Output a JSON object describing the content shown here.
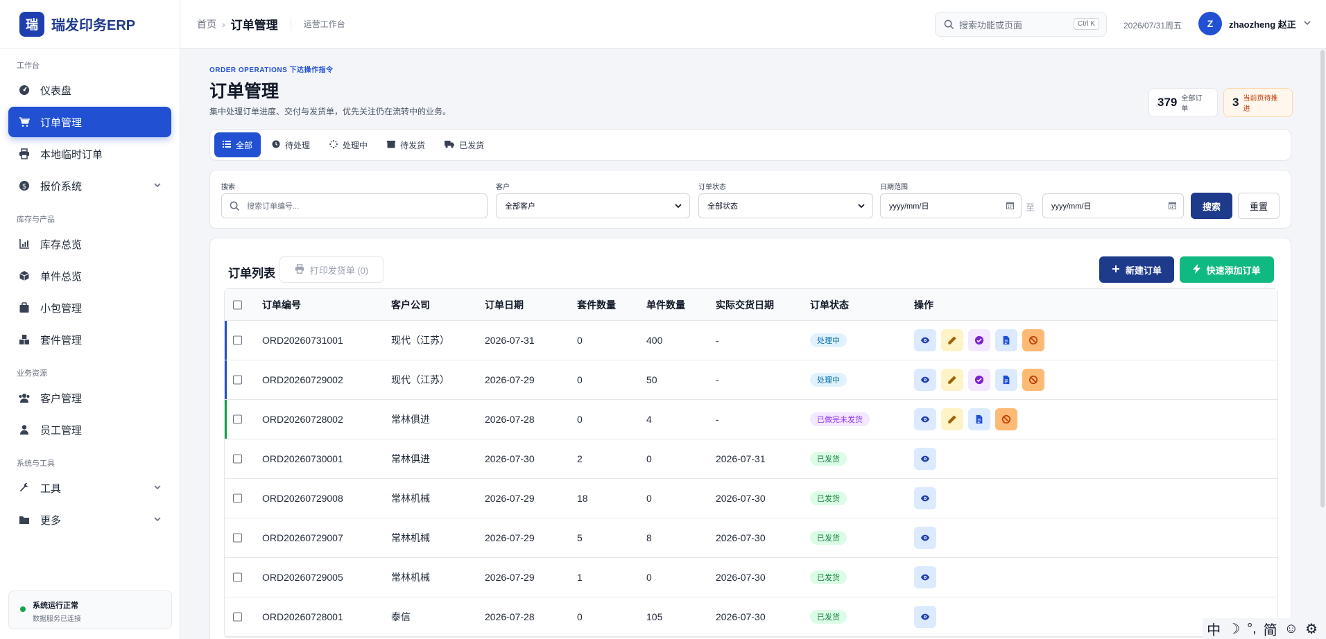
{
  "brand": {
    "logo_char": "瑞",
    "name": "瑞发印务ERP"
  },
  "sidebar": {
    "sections": {
      "workbench": "工作台",
      "inventory": "库存与产品",
      "business": "业务资源",
      "system": "系统与工具"
    },
    "items": [
      {
        "label": "仪表盘",
        "icon": "dashboard-icon"
      },
      {
        "label": "订单管理",
        "icon": "cart-icon",
        "active": true
      },
      {
        "label": "本地临时订单",
        "icon": "printer-icon"
      },
      {
        "label": "报价系统",
        "icon": "quote-icon"
      },
      {
        "label": "库存总览",
        "icon": "chart-icon"
      },
      {
        "label": "单件总览",
        "icon": "box-icon"
      },
      {
        "label": "小包管理",
        "icon": "package-icon"
      },
      {
        "label": "套件管理",
        "icon": "boxes-icon"
      },
      {
        "label": "客户管理",
        "icon": "users-icon"
      },
      {
        "label": "员工管理",
        "icon": "user-icon"
      },
      {
        "label": "工具",
        "icon": "wrench-icon"
      },
      {
        "label": "更多",
        "icon": "folder-icon"
      }
    ],
    "status": {
      "title": "系统运行正常",
      "sub": "数据服务已连接"
    }
  },
  "topbar": {
    "breadcrumb_home": "首页",
    "breadcrumb_current": "订单管理",
    "breadcrumb_tag": "运营工作台",
    "search_placeholder": "搜索功能或页面",
    "search_shortcut": "Ctrl K",
    "date": "2026/07/31周五",
    "user_initial": "Z",
    "user_name": "zhaozheng 赵正"
  },
  "page": {
    "eyebrow": "ORDER OPERATIONS  下达操作指令",
    "title": "订单管理",
    "description": "集中处理订单进度、交付与发货单，优先关注仍在流转中的业务。",
    "stat_all_num": "379",
    "stat_all_label": "全部订单",
    "stat_pending_num": "3",
    "stat_pending_label": "当前页待推进"
  },
  "tabs": [
    {
      "label": "全部",
      "icon": "list-icon"
    },
    {
      "label": "待处理",
      "icon": "clock-icon"
    },
    {
      "label": "处理中",
      "icon": "spinner-icon"
    },
    {
      "label": "待发货",
      "icon": "box-icon"
    },
    {
      "label": "已发货",
      "icon": "truck-icon"
    }
  ],
  "filters": {
    "search_label": "搜索",
    "search_placeholder": "搜索订单编号...",
    "customer_label": "客户",
    "customer_value": "全部客户",
    "status_label": "订单状态",
    "status_value": "全部状态",
    "date_label": "日期范围",
    "date_from": "yyyy/mm/日",
    "date_to": "yyyy/mm/日",
    "to_word": "至",
    "search_button": "搜索",
    "reset_button": "重置"
  },
  "list": {
    "title": "订单列表",
    "print_button": "打印发货单 (0)",
    "new_button": "新建订单",
    "quick_button": "快速添加订单"
  },
  "table": {
    "headers": [
      "订单编号",
      "客户公司",
      "订单日期",
      "套件数量",
      "单件数量",
      "实际交货日期",
      "订单状态",
      "操作"
    ],
    "rows": [
      {
        "id": "ORD20260731001",
        "customer": "现代（江苏）",
        "date": "2026-07-31",
        "kits": "0",
        "units": "400",
        "delivered": "-",
        "status": "处理中",
        "status_type": "processing",
        "bar": "blue",
        "actions": [
          "view",
          "edit",
          "confirm",
          "doc",
          "cancel"
        ]
      },
      {
        "id": "ORD20260729002",
        "customer": "现代（江苏）",
        "date": "2026-07-29",
        "kits": "0",
        "units": "50",
        "delivered": "-",
        "status": "处理中",
        "status_type": "processing",
        "bar": "blue",
        "actions": [
          "view",
          "edit",
          "confirm",
          "doc",
          "cancel"
        ]
      },
      {
        "id": "ORD20260728002",
        "customer": "常林俱进",
        "date": "2026-07-28",
        "kits": "0",
        "units": "4",
        "delivered": "-",
        "status": "已做完未发货",
        "status_type": "done",
        "bar": "green",
        "actions": [
          "view",
          "edit",
          "doc",
          "cancel"
        ]
      },
      {
        "id": "ORD20260730001",
        "customer": "常林俱进",
        "date": "2026-07-30",
        "kits": "2",
        "units": "0",
        "delivered": "2026-07-31",
        "status": "已发货",
        "status_type": "shipped",
        "bar": "",
        "actions": [
          "view"
        ]
      },
      {
        "id": "ORD20260729008",
        "customer": "常林机械",
        "date": "2026-07-29",
        "kits": "18",
        "units": "0",
        "delivered": "2026-07-30",
        "status": "已发货",
        "status_type": "shipped",
        "bar": "",
        "actions": [
          "view"
        ]
      },
      {
        "id": "ORD20260729007",
        "customer": "常林机械",
        "date": "2026-07-29",
        "kits": "5",
        "units": "8",
        "delivered": "2026-07-30",
        "status": "已发货",
        "status_type": "shipped",
        "bar": "",
        "actions": [
          "view"
        ]
      },
      {
        "id": "ORD20260729005",
        "customer": "常林机械",
        "date": "2026-07-29",
        "kits": "1",
        "units": "0",
        "delivered": "2026-07-30",
        "status": "已发货",
        "status_type": "shipped",
        "bar": "",
        "actions": [
          "view"
        ]
      },
      {
        "id": "ORD20260728001",
        "customer": "泰信",
        "date": "2026-07-28",
        "kits": "0",
        "units": "105",
        "delivered": "2026-07-30",
        "status": "已发货",
        "status_type": "shipped",
        "bar": "",
        "actions": [
          "view"
        ]
      }
    ]
  },
  "ime": {
    "lang": "中",
    "moon": "☽",
    "punct": "°,",
    "script": "简",
    "emoji": "☺",
    "gear": "⚙"
  },
  "colors": {
    "primary": "#2151d2",
    "navy": "#1e3a8a",
    "green": "#10b981"
  }
}
